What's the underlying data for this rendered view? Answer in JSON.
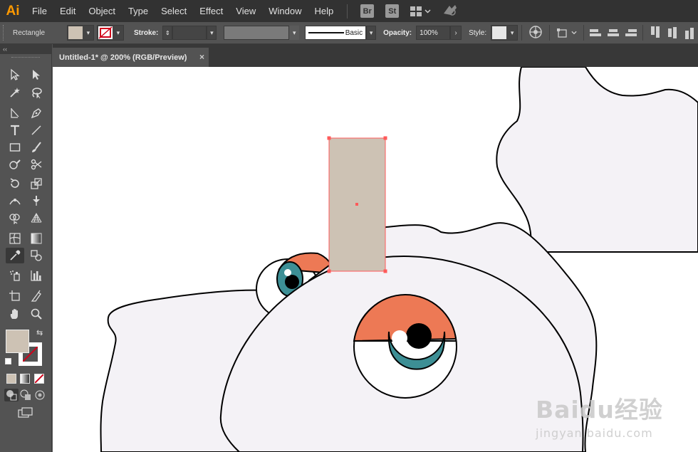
{
  "app": {
    "logo": "Ai"
  },
  "menu": [
    "File",
    "Edit",
    "Object",
    "Type",
    "Select",
    "Effect",
    "View",
    "Window",
    "Help"
  ],
  "menu_badges": {
    "bridge": "Br",
    "stock": "St"
  },
  "control_bar": {
    "object_type": "Rectangle",
    "fill_color": "#cdc2b4",
    "stroke_label": "Stroke:",
    "brush_label": "Basic",
    "opacity_label": "Opacity:",
    "opacity_value": "100%",
    "style_label": "Style:"
  },
  "document_tab": {
    "title": "Untitled-1* @ 200% (RGB/Preview)",
    "close": "×"
  },
  "toolbar": {
    "collapse": "‹‹",
    "fill_color": "#cdc2b4",
    "stroke_color": "none"
  },
  "artwork": {
    "body_color": "#f4f2f6",
    "eyelid_color": "#ed7955",
    "iris_color": "#3d8f95",
    "selected_rect_color": "#cdc2b4",
    "selection_color": "#ff5a5a"
  },
  "watermark": {
    "main": "Baidu经验",
    "sub": "jingyan.baidu.com"
  }
}
